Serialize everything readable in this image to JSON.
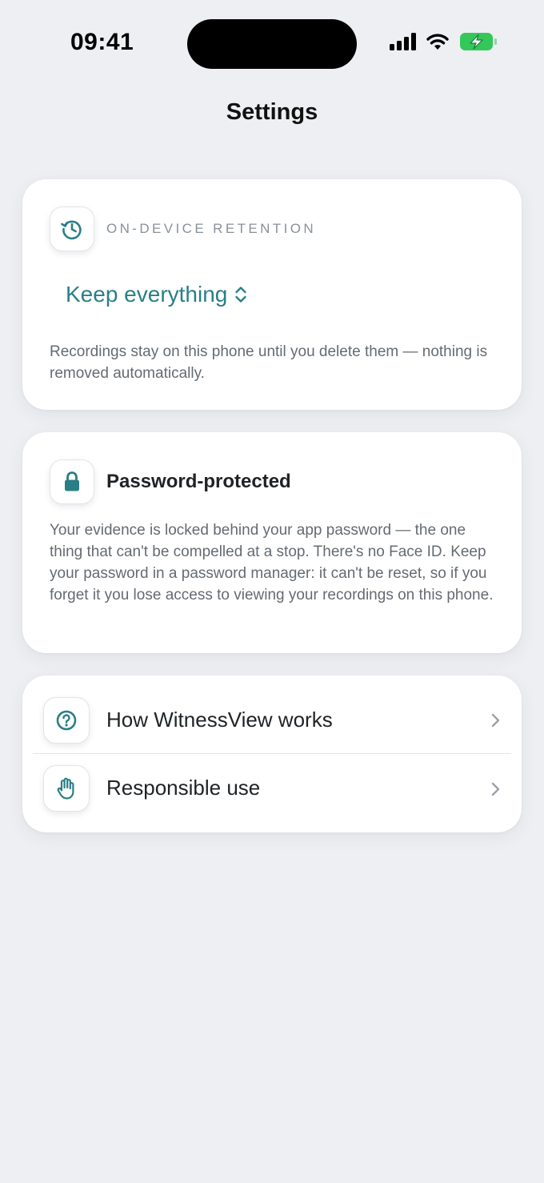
{
  "status_bar": {
    "time": "09:41",
    "icons": [
      "cellular-signal-icon",
      "wifi-icon",
      "battery-charging-icon"
    ]
  },
  "header": {
    "title": "Settings"
  },
  "retention": {
    "label": "ON-DEVICE RETENTION",
    "icon": "history-clock-icon",
    "selected_option": "Keep everything",
    "description": "Recordings stay on this phone until you delete them — nothing is removed automatically."
  },
  "password": {
    "icon": "lock-icon",
    "title": "Password-protected",
    "description": "Your evidence is locked behind your app password — the one thing that can't be compelled at a stop. There's no Face ID. Keep your password in a password manager: it can't be reset, so if you forget it you lose access to viewing your recordings on this phone."
  },
  "links": [
    {
      "icon": "question-circle-icon",
      "label": "How WitnessView works"
    },
    {
      "icon": "hand-raised-icon",
      "label": "Responsible use"
    }
  ],
  "colors": {
    "accent": "#2a7f86",
    "background": "#eeeff3",
    "card": "#ffffff",
    "battery_green": "#34c759"
  }
}
